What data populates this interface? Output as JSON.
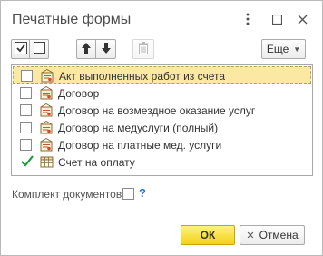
{
  "dialog": {
    "title": "Печатные формы"
  },
  "toolbar": {
    "more_label": "Еще",
    "icons": [
      "check-all-icon",
      "uncheck-all-icon",
      "move-up-icon",
      "move-down-icon",
      "delete-icon"
    ]
  },
  "list": {
    "items": [
      {
        "label": "Акт выполненных работ из счета",
        "checked": false,
        "icon": "print-form-icon",
        "selected": true
      },
      {
        "label": "Договор",
        "checked": false,
        "icon": "print-form-icon",
        "selected": false
      },
      {
        "label": "Договор на возмездное оказание услуг",
        "checked": false,
        "icon": "print-form-icon",
        "selected": false
      },
      {
        "label": "Договор на медуслуги (полный)",
        "checked": false,
        "icon": "print-form-icon",
        "selected": false
      },
      {
        "label": "Договор на платные мед. услуги",
        "checked": false,
        "icon": "print-form-icon",
        "selected": false
      },
      {
        "label": "Счет на оплату",
        "checked": true,
        "icon": "spreadsheet-icon",
        "selected": false
      }
    ]
  },
  "kit": {
    "label": "Комплект документов:",
    "checked": false,
    "help": "?"
  },
  "footer": {
    "ok_label": "ОК",
    "cancel_label": "Отмена"
  },
  "colors": {
    "accent_yellow": "#f2d21a",
    "selection": "#fbe8a3",
    "check_green": "#1e9c3a",
    "help_blue": "#2a76c4"
  }
}
